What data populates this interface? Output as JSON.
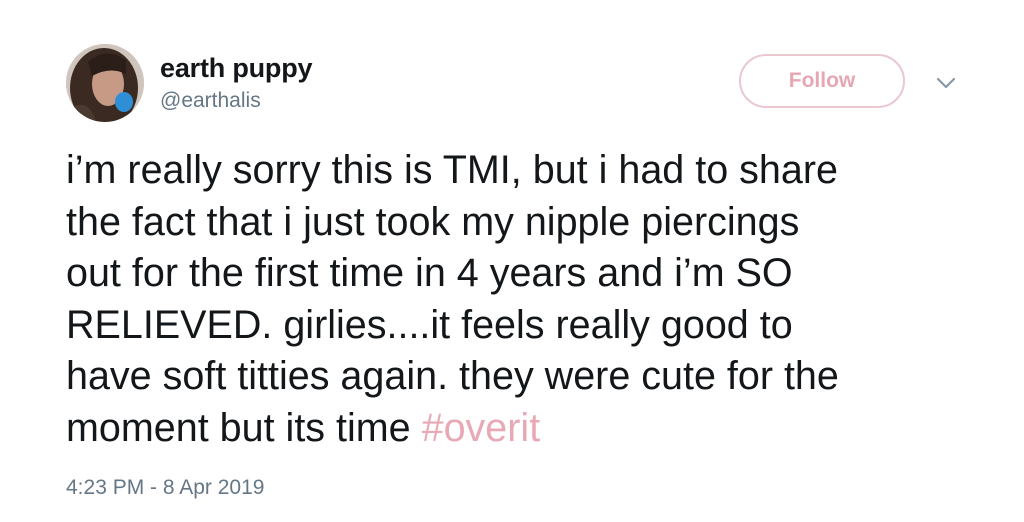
{
  "author": {
    "display_name": "earth puppy",
    "handle": "@earthalis"
  },
  "actions": {
    "follow_label": "Follow",
    "menu_icon": "chevron-down-icon"
  },
  "tweet": {
    "lines": [
      "i’m really sorry this is TMI, but i had to share",
      "the fact that i just took my nipple piercings",
      "out for the first time in 4 years and i’m SO",
      "RELIEVED. girlies....it feels really good to",
      "have soft titties again. they were cute for the",
      "moment but its time "
    ],
    "hashtag": "#overit"
  },
  "timestamp": "4:23 PM - 8 Apr 2019",
  "colors": {
    "text": "#14171a",
    "secondary": "#657786",
    "accent": "#e8a9b5",
    "follow_border": "#e9c8cf"
  }
}
